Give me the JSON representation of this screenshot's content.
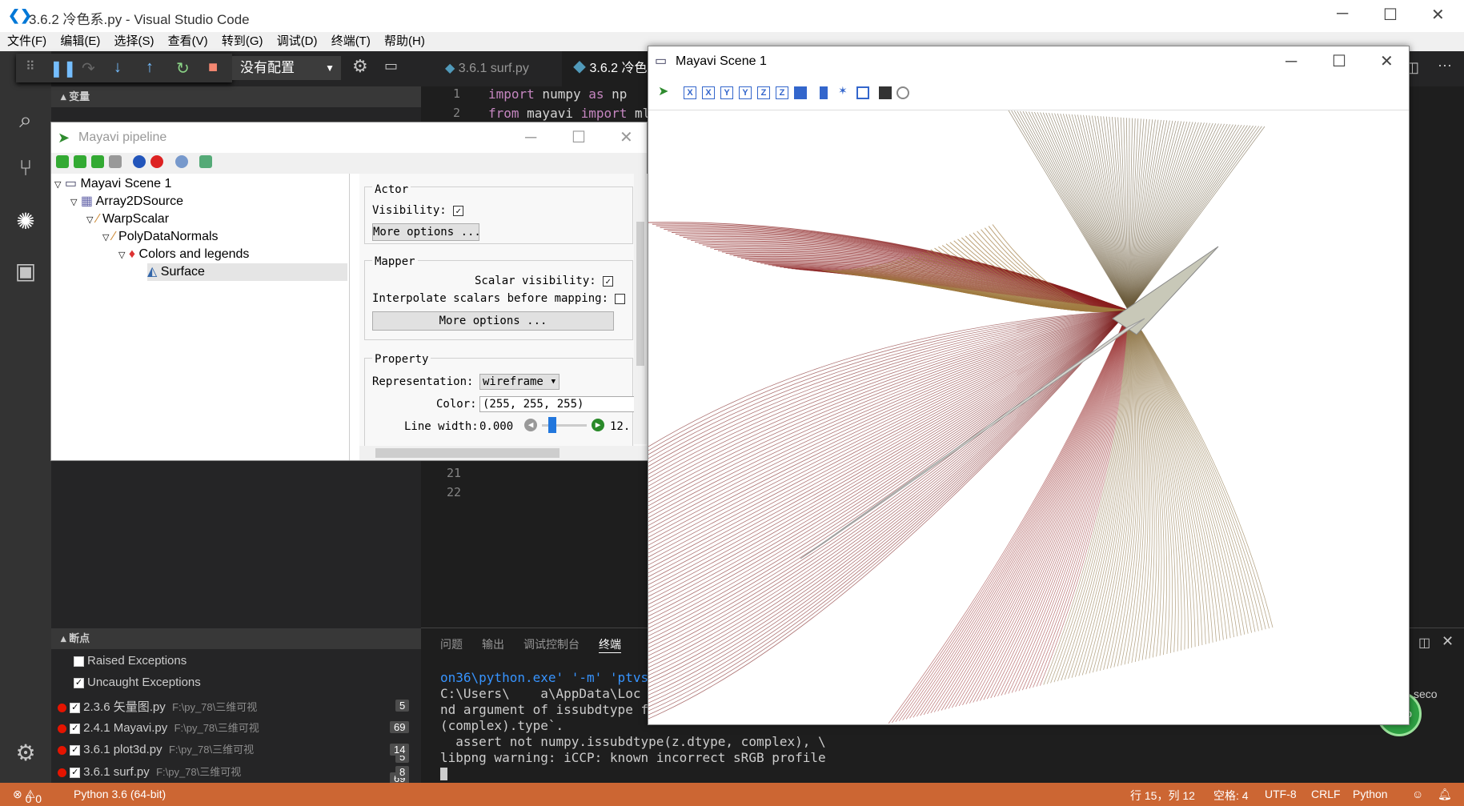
{
  "vscode": {
    "title": "3.6.2 冷色系.py - Visual Studio Code",
    "menu": [
      "文件(F)",
      "编辑(E)",
      "选择(S)",
      "查看(V)",
      "转到(G)",
      "调试(D)",
      "终端(T)",
      "帮助(H)"
    ],
    "debug_config": "没有配置",
    "tabs": [
      "3.6.1 surf.py",
      "3.6.2 冷色系"
    ],
    "code_lines": [
      {
        "no": "1",
        "text_kw": "import",
        "text_rest": " numpy ",
        "text_kw2": "as",
        "text_rest2": " np"
      },
      {
        "no": "2",
        "text_kw": "from",
        "text_rest": " mayavi ",
        "text_kw2": "import",
        "text_rest2": " ml"
      }
    ],
    "line_21": "21",
    "line_22": "22",
    "variables_header": "变量",
    "breakpoints_header": "断点",
    "breakpoints": [
      {
        "label": "Raised Exceptions",
        "checked": false
      },
      {
        "label": "Uncaught Exceptions",
        "checked": true
      }
    ],
    "bp_files": [
      {
        "name": "2.3.6 矢量图.py",
        "path": "F:\\py_78\\三维可视",
        "count": "5"
      },
      {
        "name": "2.4.1 Mayavi.py",
        "path": "F:\\py_78\\三维可视",
        "count": "69"
      },
      {
        "name": "3.6.1 plot3d.py",
        "path": "F:\\py_78\\三维可视",
        "count": "14"
      },
      {
        "name": "3.6.1 surf.py",
        "path": "F:\\py_78\\三维可视",
        "count": "8"
      }
    ],
    "panel_tabs": [
      "问题",
      "输出",
      "调试控制台",
      "终端"
    ],
    "terminal": [
      "on36\\python.exe' '-m' 'ptvsd'",
      "C:\\Users\\    a\\AppData\\Loc",
      "nd argument of issubdtype fro",
      "(complex).type`.",
      "  assert not numpy.issubdtype(z.dtype, complex), \\",
      "libpng warning: iCCP: known incorrect sRGB profile"
    ],
    "status": {
      "errors": "0",
      "warnings": "0",
      "interpreter": "Python 3.6 (64-bit)",
      "position": "行 15，列 12",
      "spaces": "空格: 4",
      "encoding": "UTF-8",
      "eol": "CRLF",
      "language": "Python"
    },
    "percent": "60%",
    "right_fragment": "seco"
  },
  "pipeline": {
    "title": "Mayavi pipeline",
    "tree": [
      "Mayavi Scene 1",
      "Array2DSource",
      "WarpScalar",
      "PolyDataNormals",
      "Colors and legends",
      "Surface"
    ],
    "actor_label": "Actor",
    "visibility_label": "Visibility:",
    "more_options": "More options ...",
    "mapper_label": "Mapper",
    "scalar_visibility_label": "Scalar visibility:",
    "interpolate_label": "Interpolate scalars before mapping:",
    "property_label": "Property",
    "representation_label": "Representation:",
    "representation_value": "wireframe",
    "color_label": "Color:",
    "color_value": "(255, 255, 255)",
    "line_width_label": "Line width:",
    "line_width_value": "0.000",
    "line_width_max": "12."
  },
  "scene": {
    "title": "Mayavi Scene 1"
  },
  "colors": {
    "status_bar": "#cc6633",
    "breakpoint": "#e51400",
    "keyword": "#c586c0"
  }
}
